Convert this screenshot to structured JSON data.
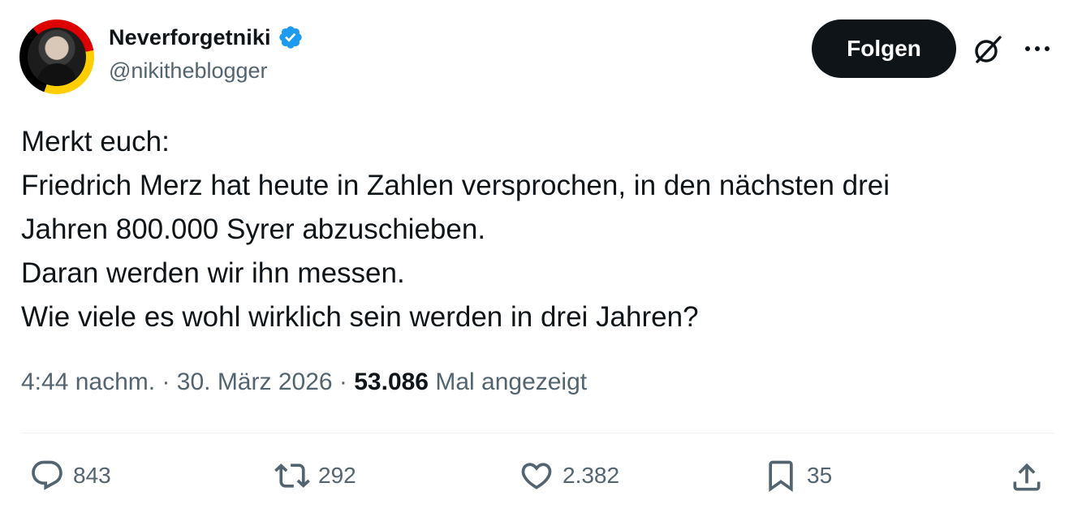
{
  "author": {
    "display_name": "Neverforgetniki",
    "handle": "@nikitheblogger",
    "verified": true
  },
  "follow_button": {
    "label": "Folgen"
  },
  "tweet": {
    "lines": [
      "Merkt euch:",
      "Friedrich Merz hat heute in Zahlen versprochen, in den nächsten drei",
      "Jahren 800.000 Syrer abzuschieben.",
      "Daran werden wir ihn messen.",
      "Wie viele es wohl wirklich sein werden in drei Jahren?"
    ]
  },
  "meta": {
    "time": "4:44 nachm.",
    "separator": " · ",
    "date": "30. März 2026",
    "views_count": "53.086",
    "views_label": " Mal angezeigt"
  },
  "actions": {
    "replies": "843",
    "reposts": "292",
    "likes": "2.382",
    "bookmarks": "35"
  },
  "colors": {
    "text_primary": "#0f1419",
    "text_secondary": "#536471",
    "verified_blue": "#1d9bf0",
    "divider": "#eff3f4"
  },
  "icons": {
    "verified": "verified-badge-icon",
    "grok": "grok-icon",
    "more": "more-dots-icon",
    "reply": "reply-icon",
    "repost": "repost-icon",
    "like": "heart-icon",
    "bookmark": "bookmark-icon",
    "share": "share-icon"
  }
}
